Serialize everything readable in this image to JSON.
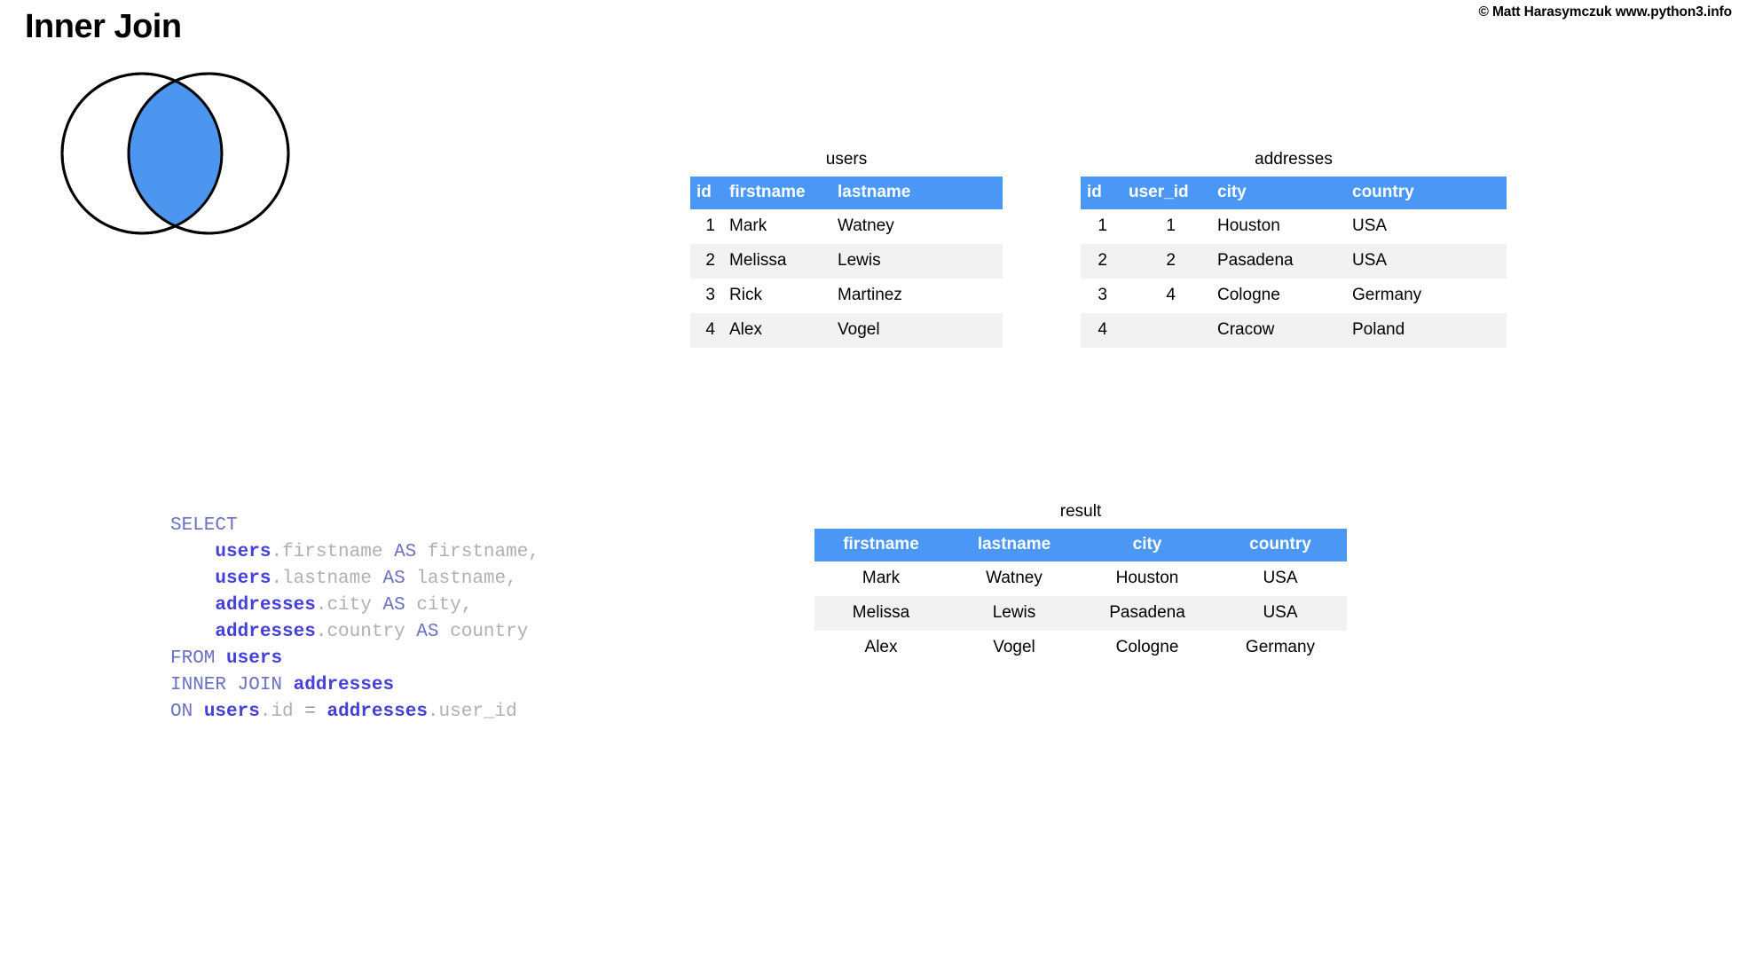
{
  "header": {
    "title": "Inner Join",
    "copyright": "© Matt Harasymczuk www.python3.info"
  },
  "colors": {
    "accent_blue": "#4a97f5",
    "venn_intersection": "#4d96f0",
    "row_alt": "#f2f2f2",
    "outline": "#000000",
    "code_keyword": "#6b6fc6",
    "code_table": "#4540d8",
    "code_identifier": "#b0b0b0"
  },
  "venn": {
    "label": "inner-join-venn",
    "left_circle_fill": "#ffffff",
    "right_circle_fill": "#ffffff",
    "intersection_fill": "#4d96f0",
    "stroke": "#000000"
  },
  "tables": {
    "users": {
      "caption": "users",
      "columns": [
        "id",
        "firstname",
        "lastname"
      ],
      "rows": [
        [
          "1",
          "Mark",
          "Watney"
        ],
        [
          "2",
          "Melissa",
          "Lewis"
        ],
        [
          "3",
          "Rick",
          "Martinez"
        ],
        [
          "4",
          "Alex",
          "Vogel"
        ]
      ]
    },
    "addresses": {
      "caption": "addresses",
      "columns": [
        "id",
        "user_id",
        "city",
        "country"
      ],
      "rows": [
        [
          "1",
          "1",
          "Houston",
          "USA"
        ],
        [
          "2",
          "2",
          "Pasadena",
          "USA"
        ],
        [
          "3",
          "4",
          "Cologne",
          "Germany"
        ],
        [
          "4",
          "",
          "Cracow",
          "Poland"
        ]
      ]
    },
    "result": {
      "caption": "result",
      "columns": [
        "firstname",
        "lastname",
        "city",
        "country"
      ],
      "rows": [
        [
          "Mark",
          "Watney",
          "Houston",
          "USA"
        ],
        [
          "Melissa",
          "Lewis",
          "Pasadena",
          "USA"
        ],
        [
          "Alex",
          "Vogel",
          "Cologne",
          "Germany"
        ]
      ]
    }
  },
  "code": {
    "language": "sql",
    "lines": [
      "SELECT",
      "    users.firstname AS firstname,",
      "    users.lastname AS lastname,",
      "    addresses.city AS city,",
      "    addresses.country AS country",
      "FROM users",
      "INNER JOIN addresses",
      "ON users.id = addresses.user_id"
    ],
    "tokens": {
      "select": "SELECT",
      "as": "AS",
      "from": "FROM",
      "inner_join": "INNER JOIN",
      "on": "ON",
      "eq": "=",
      "t_users": "users",
      "t_addresses": "addresses",
      "c_firstname": "firstname",
      "c_lastname": "lastname",
      "c_city": "city",
      "c_country": "country",
      "c_id": "id",
      "c_user_id": "user_id",
      "dot": ".",
      "comma": ","
    }
  }
}
